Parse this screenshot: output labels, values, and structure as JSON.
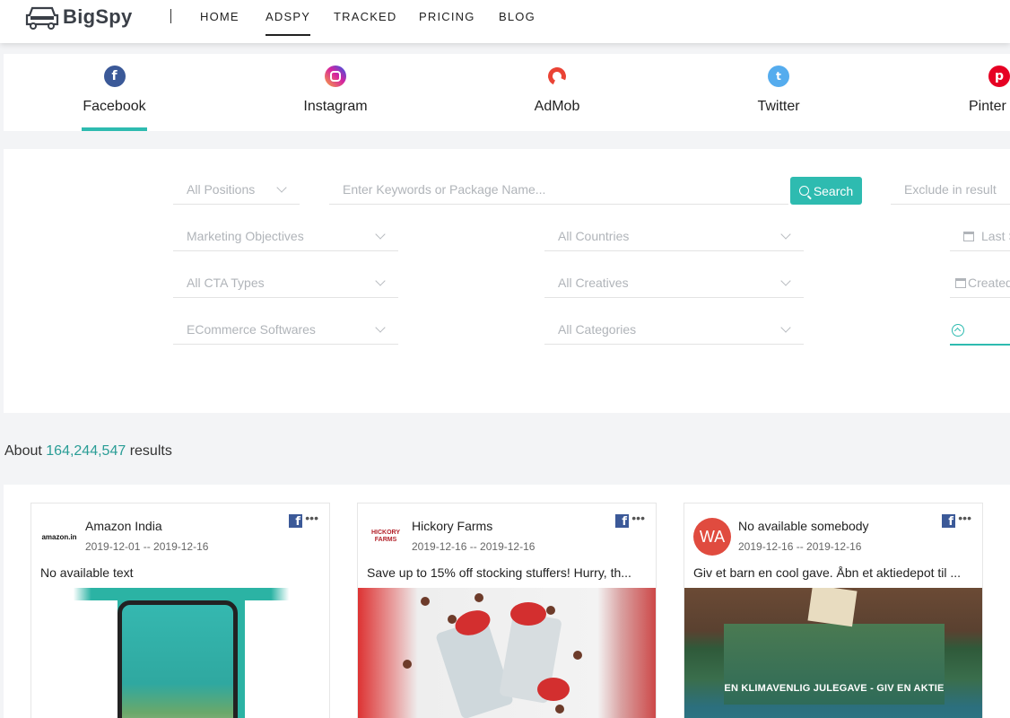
{
  "nav": {
    "brand": "BigSpy",
    "links": [
      "HOME",
      "ADSPY",
      "TRACKED",
      "PRICING",
      "BLOG"
    ],
    "active": "ADSPY"
  },
  "platforms": [
    {
      "label": "Facebook",
      "icon": "facebook-icon",
      "color": "#3b5998",
      "active": true
    },
    {
      "label": "Instagram",
      "icon": "instagram-icon",
      "color": "#d6249f",
      "active": false
    },
    {
      "label": "AdMob",
      "icon": "admob-icon",
      "color": "#ea4335",
      "active": false
    },
    {
      "label": "Twitter",
      "icon": "twitter-icon",
      "color": "#55acee",
      "active": false
    },
    {
      "label": "Pinter",
      "icon": "pinterest-icon",
      "color": "#e60023",
      "active": false
    }
  ],
  "filters": {
    "positions": "All Positions",
    "keyword_placeholder": "Enter Keywords or Package Name...",
    "search_label": "Search",
    "exclude": "Exclude in result",
    "marketing_objectives": "Marketing Objectives",
    "countries": "All Countries",
    "last_seen": "Last S",
    "cta_types": "All CTA Types",
    "creatives": "All Creatives",
    "created": "Created",
    "ecommerce": "ECommerce Softwares",
    "categories": "All Categories"
  },
  "results": {
    "prefix": "About",
    "count": "164,244,547",
    "suffix": "results"
  },
  "cards": [
    {
      "advertiser": "Amazon India",
      "dates": "2019-12-01 -- 2019-12-16",
      "text": "No available text",
      "avatar_text": "amazon.in"
    },
    {
      "advertiser": "Hickory Farms",
      "dates": "2019-12-16 -- 2019-12-16",
      "text": "Save up to 15% off stocking stuffers! Hurry, th...",
      "avatar_text": "HICKORY FARMS"
    },
    {
      "advertiser": "No available somebody",
      "dates": "2019-12-16 -- 2019-12-16",
      "text": "Giv et barn en cool gave. Åbn et aktiedepot til ...",
      "avatar_text": "WA",
      "media_caption": "EN KLIMAVENLIG JULEGAVE - GIV EN AKTIE"
    }
  ],
  "colors": {
    "accent": "#2ebbb0",
    "count": "#2a9d96"
  }
}
